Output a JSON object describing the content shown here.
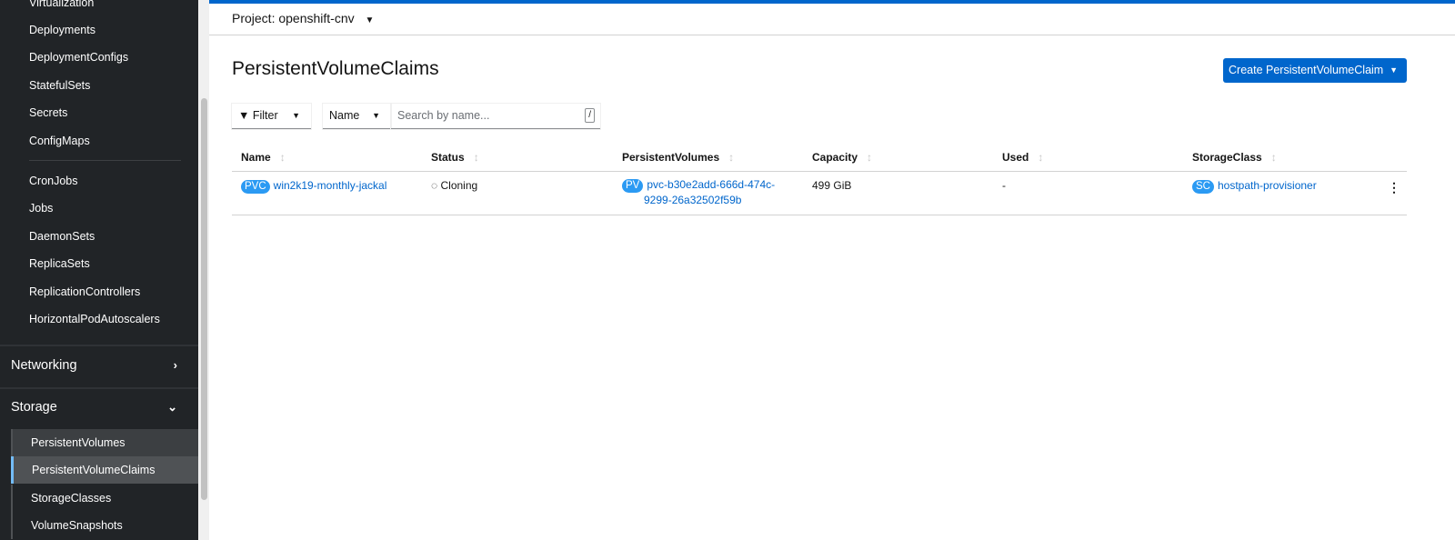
{
  "sidebar": {
    "top_items": [
      "Virtualization",
      "Deployments",
      "DeploymentConfigs",
      "StatefulSets",
      "Secrets",
      "ConfigMaps"
    ],
    "workload_items": [
      "CronJobs",
      "Jobs",
      "DaemonSets",
      "ReplicaSets",
      "ReplicationControllers",
      "HorizontalPodAutoscalers"
    ],
    "networking": "Networking",
    "storage": "Storage",
    "storage_items": [
      "PersistentVolumes",
      "PersistentVolumeClaims",
      "StorageClasses",
      "VolumeSnapshots"
    ],
    "active": "PersistentVolumeClaims"
  },
  "project": "Project: openshift-cnv",
  "page_title": "PersistentVolumeClaims",
  "create_button": "Create PersistentVolumeClaim",
  "toolbar": {
    "filter": "Filter",
    "name_select": "Name",
    "search_placeholder": "Search by name...",
    "shortcut": "/"
  },
  "table": {
    "headers": [
      "Name",
      "Status",
      "PersistentVolumes",
      "Capacity",
      "Used",
      "StorageClass"
    ],
    "rows": [
      {
        "name_badge": "PVC",
        "name": "win2k19-monthly-jackal",
        "status": "Cloning",
        "pv_badge": "PV",
        "pv_line1": "pvc-b30e2add-666d-474c-",
        "pv_line2": "9299-26a32502f59b",
        "capacity": "499 GiB",
        "used": "-",
        "sc_badge": "SC",
        "storage_class": "hostpath-provisioner"
      }
    ]
  },
  "colors": {
    "accent": "#0066cc",
    "badge": "#2b9af3",
    "sidebar": "#212427"
  }
}
